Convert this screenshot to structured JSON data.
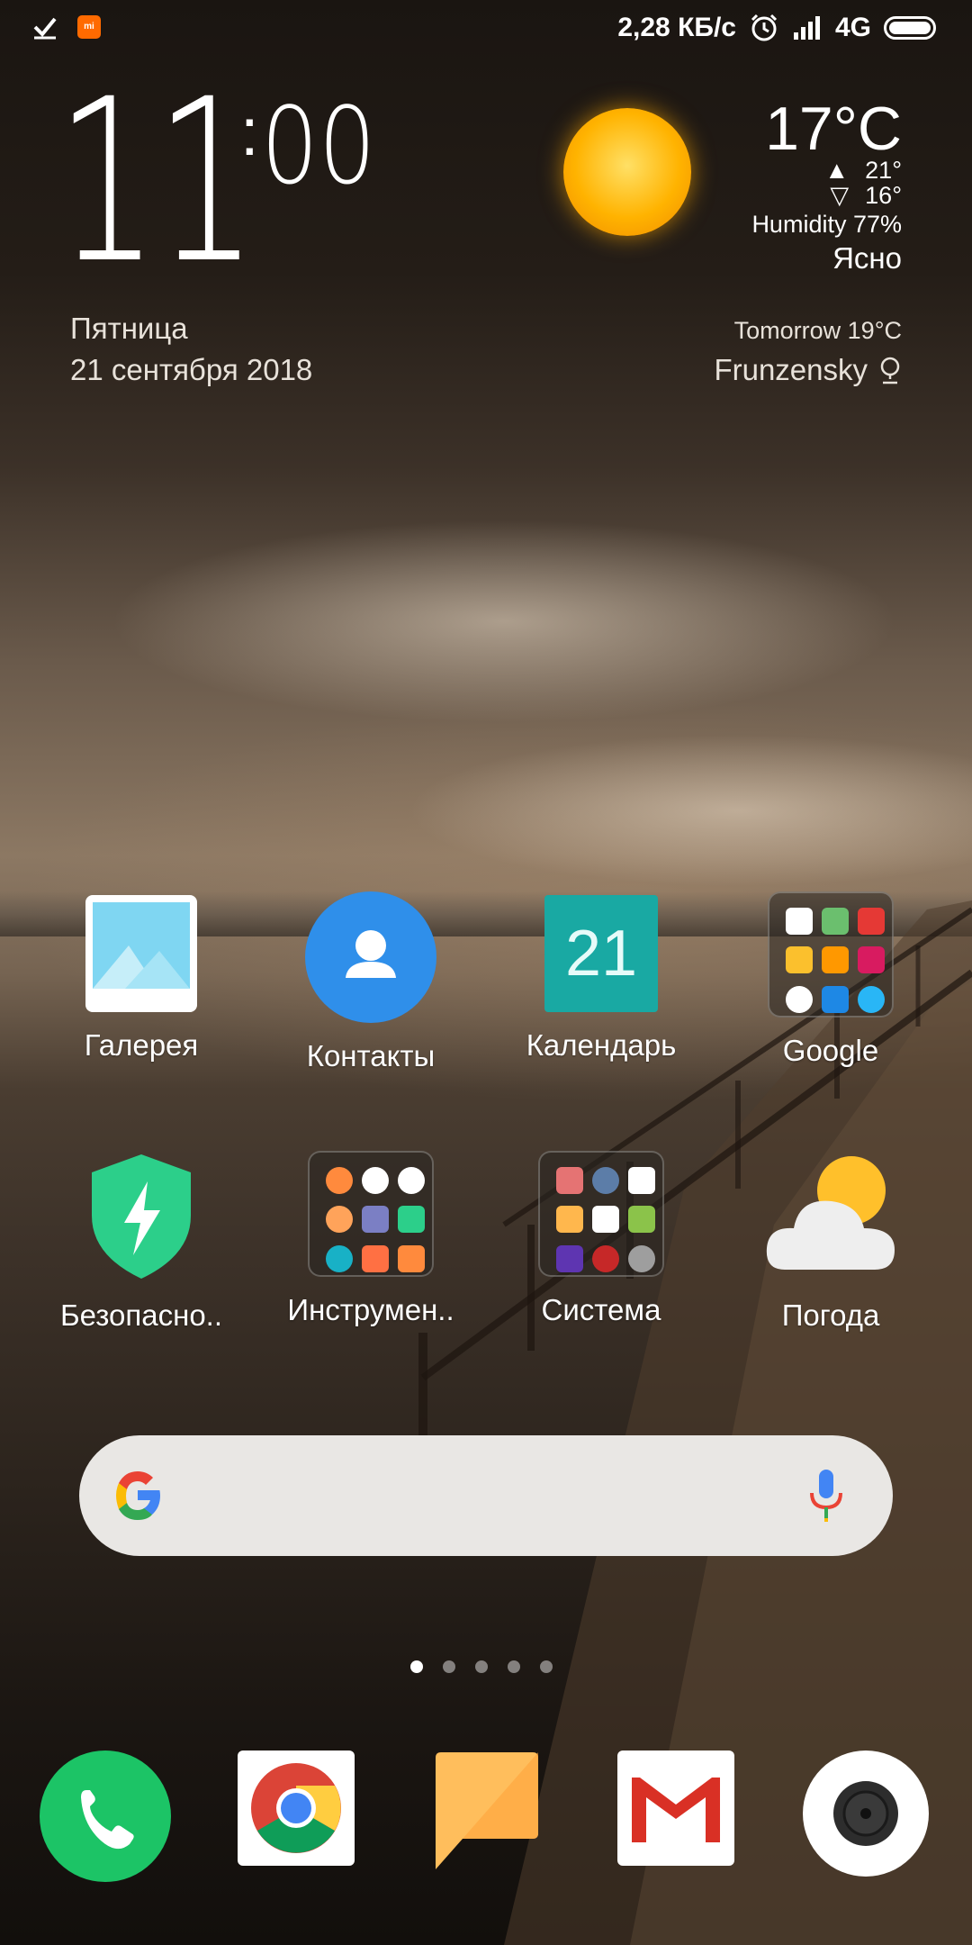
{
  "status_bar": {
    "net_speed": "2,28 КБ/с",
    "network": "4G"
  },
  "clock": {
    "hours": "11",
    "separator": ":",
    "minutes": "00",
    "day_of_week": "Пятница",
    "date": "21 сентября 2018"
  },
  "weather": {
    "temperature": "17°C",
    "high": "21°",
    "low": "16°",
    "humidity": "Humidity 77%",
    "condition": "Ясно",
    "tomorrow": "Tomorrow 19°C",
    "location": "Frunzensky"
  },
  "apps": [
    {
      "label": "Галерея",
      "icon": "gallery-icon"
    },
    {
      "label": "Контакты",
      "icon": "contacts-icon"
    },
    {
      "label": "Календарь",
      "icon": "calendar-icon",
      "day": "21"
    },
    {
      "label": "Google",
      "icon": "google-folder-icon"
    },
    {
      "label": "Безопасно..",
      "icon": "security-icon"
    },
    {
      "label": "Инструмен..",
      "icon": "tools-folder-icon"
    },
    {
      "label": "Система",
      "icon": "system-folder-icon"
    },
    {
      "label": "Погода",
      "icon": "weather-icon"
    }
  ],
  "search_bar": {
    "logo": "google-g-icon",
    "mic": "microphone-icon"
  },
  "pages": {
    "count": 5,
    "active": 1
  },
  "dock": [
    {
      "icon": "phone-icon"
    },
    {
      "icon": "chrome-icon"
    },
    {
      "icon": "messages-icon"
    },
    {
      "icon": "gmail-icon"
    },
    {
      "icon": "camera-icon"
    }
  ],
  "colors": {
    "contacts_blue": "#2f8fea",
    "calendar_teal": "#19a9a3",
    "security_green": "#2ccf8a",
    "phone_green": "#1cc466",
    "messages_orange": "#ffbe5c"
  }
}
